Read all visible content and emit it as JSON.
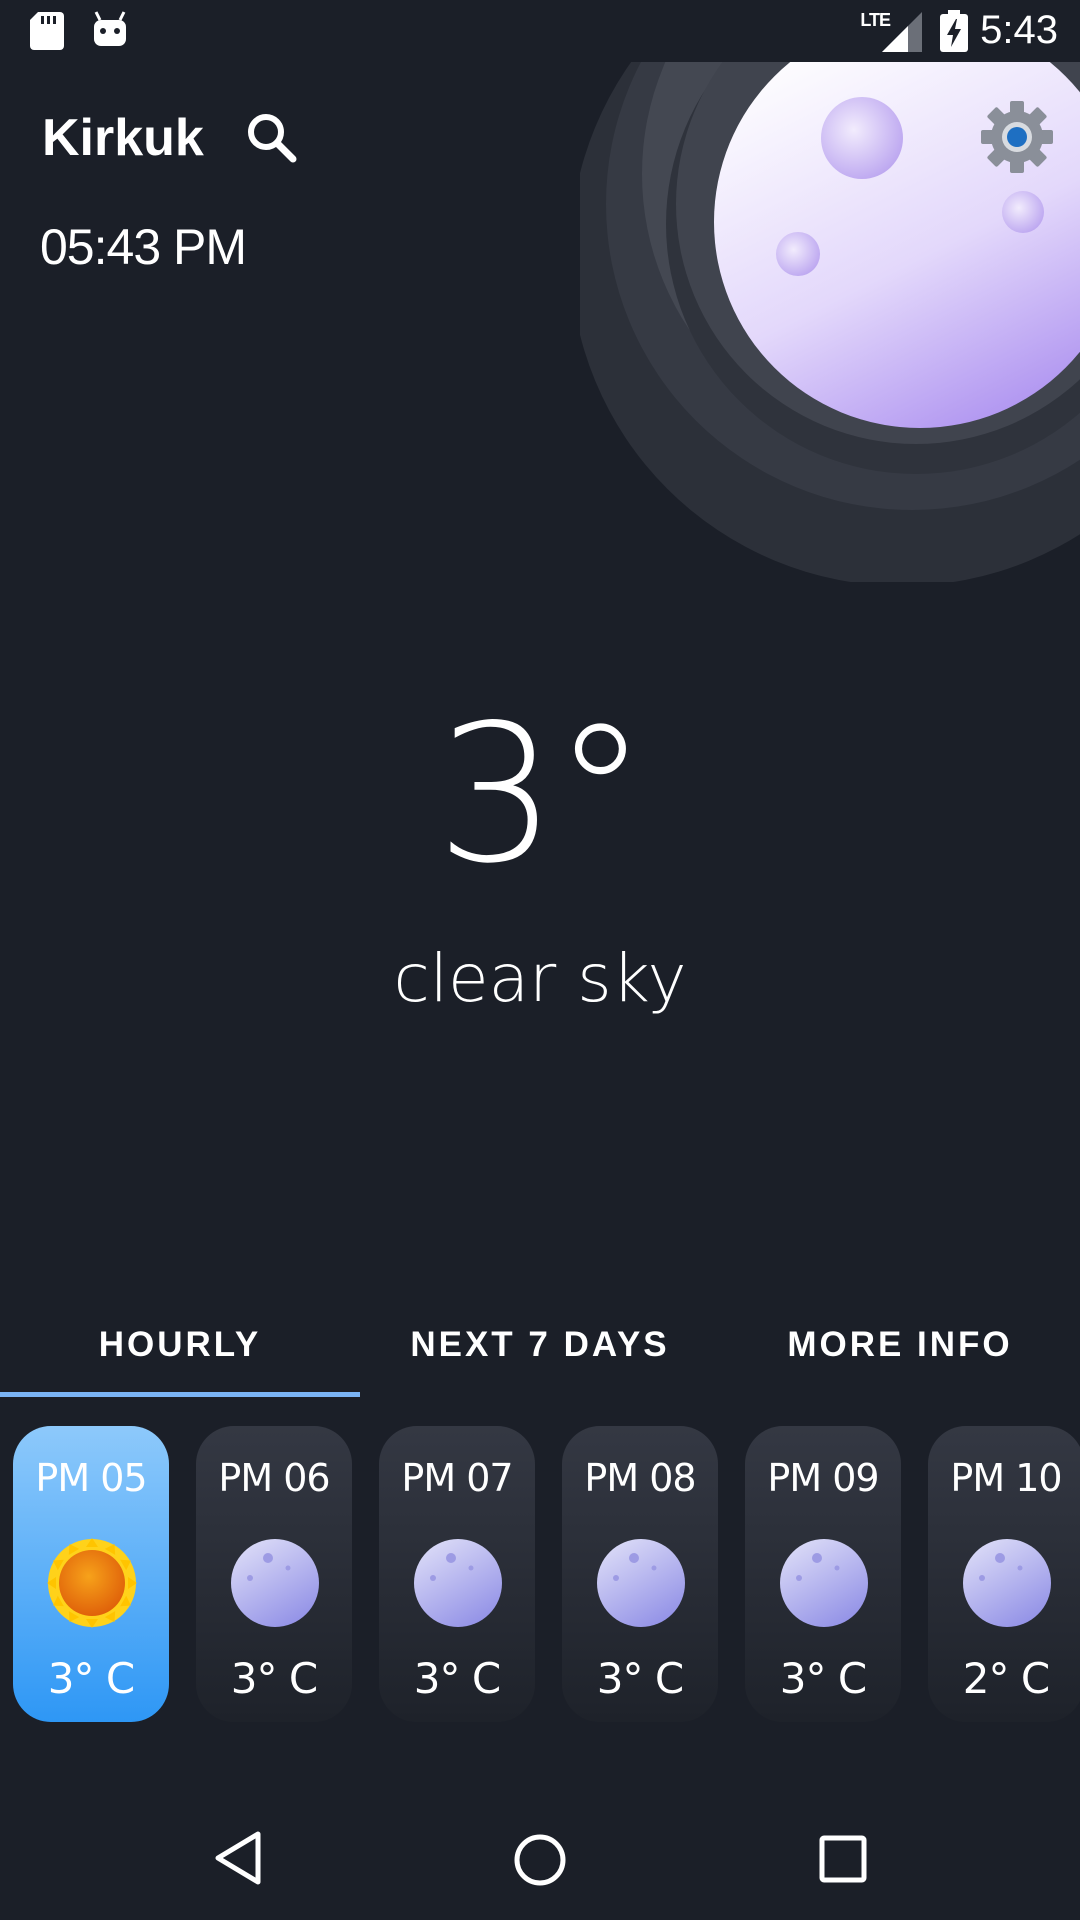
{
  "status_bar": {
    "time": "5:43",
    "network": "LTE"
  },
  "header": {
    "city": "Kirkuk",
    "local_time": "05:43 PM"
  },
  "current": {
    "temperature": "3°",
    "condition": "clear sky"
  },
  "tabs": [
    {
      "label": "HOURLY",
      "selected": true
    },
    {
      "label": "NEXT 7 DAYS",
      "selected": false
    },
    {
      "label": "MORE INFO",
      "selected": false
    }
  ],
  "hourly": [
    {
      "hour": "PM 05",
      "temp": "3° C",
      "icon": "sun-icon",
      "active": true
    },
    {
      "hour": "PM 06",
      "temp": "3° C",
      "icon": "moon-icon",
      "active": false
    },
    {
      "hour": "PM 07",
      "temp": "3° C",
      "icon": "moon-icon",
      "active": false
    },
    {
      "hour": "PM 08",
      "temp": "3° C",
      "icon": "moon-icon",
      "active": false
    },
    {
      "hour": "PM 09",
      "temp": "3° C",
      "icon": "moon-icon",
      "active": false
    },
    {
      "hour": "PM 10",
      "temp": "2° C",
      "icon": "moon-icon",
      "active": false
    }
  ],
  "colors": {
    "background": "#1b1f28",
    "accent": "#7ab4f5",
    "active_card_top": "#8dc9fb",
    "active_card_bottom": "#2e97f5",
    "moon_light": "#ffffff",
    "moon_dark": "#a98cef"
  }
}
